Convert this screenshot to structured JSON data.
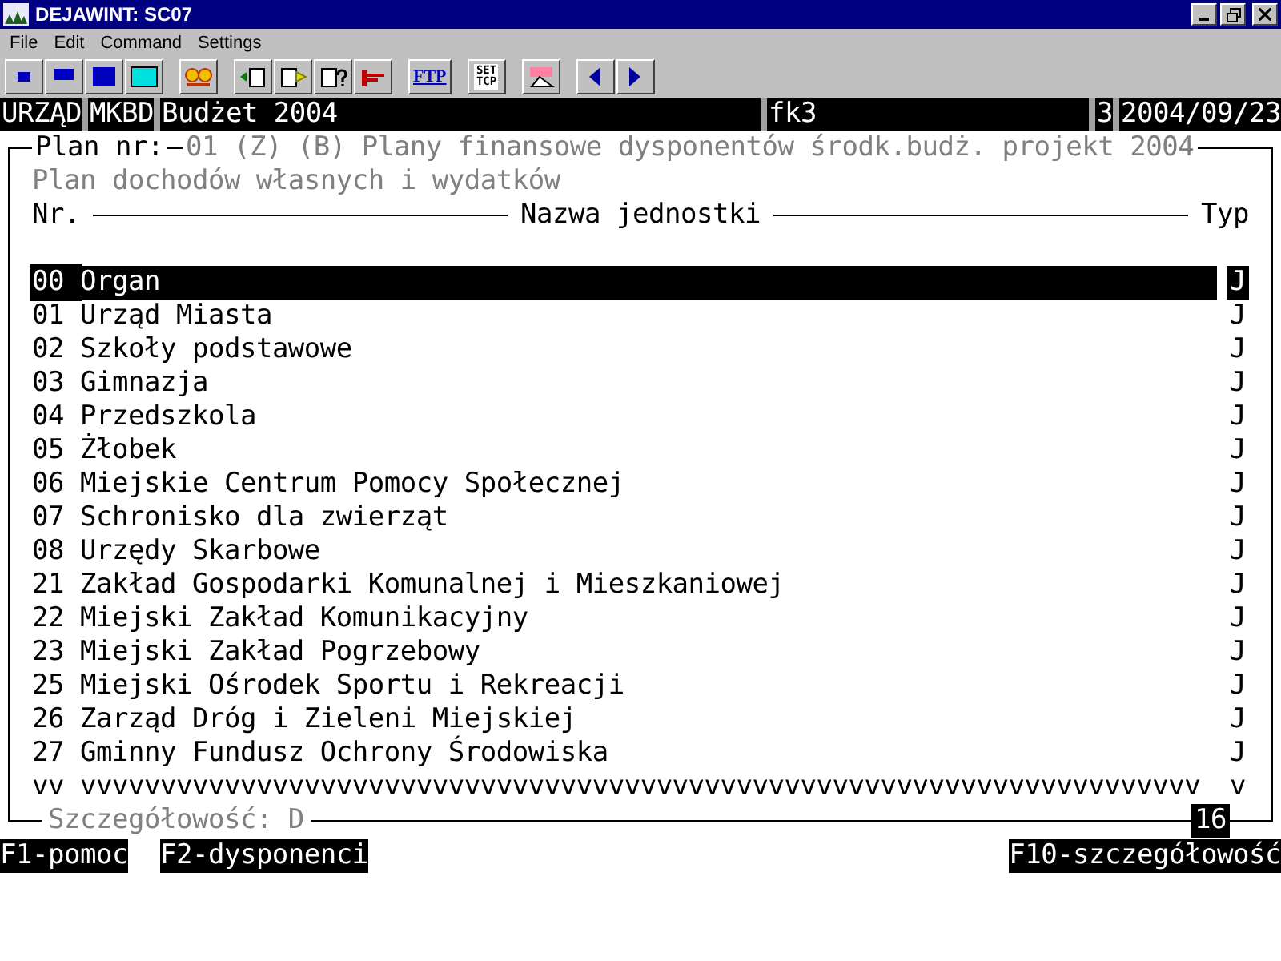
{
  "window": {
    "title": "DEJAWINT:  SC07"
  },
  "menu": [
    "File",
    "Edit",
    "Command",
    "Settings"
  ],
  "toolbar": [
    {
      "kind": "win-small"
    },
    {
      "kind": "win-medium"
    },
    {
      "kind": "win-large"
    },
    {
      "kind": "win-cyan"
    },
    {
      "kind": "flowers"
    },
    {
      "kind": "clip-in"
    },
    {
      "kind": "clip-out"
    },
    {
      "kind": "clip-question"
    },
    {
      "kind": "plug"
    },
    {
      "kind": "label",
      "label": "FTP"
    },
    {
      "kind": "label2",
      "label": "SET",
      "label2": "TCP"
    },
    {
      "kind": "tceip"
    },
    {
      "kind": "left"
    },
    {
      "kind": "right"
    }
  ],
  "status": [
    "URZĄD",
    "MKBD",
    "Budżet 2004",
    "fk3",
    "3",
    "2004/09/23"
  ],
  "plan": {
    "label": "Plan nr:",
    "value": "01 (Z) (B) Plany finansowe dysponentów środk.budż. projekt 2004",
    "subtitle": "Plan dochodów własnych i wydatków"
  },
  "columns": [
    "Nr.",
    "Nazwa jednostki",
    "Typ"
  ],
  "rows": [
    {
      "nr": "00",
      "name": "Organ",
      "type": "J",
      "selected": true
    },
    {
      "nr": "01",
      "name": "Urząd Miasta",
      "type": "J",
      "selected": false
    },
    {
      "nr": "02",
      "name": "Szkoły podstawowe",
      "type": "J",
      "selected": false
    },
    {
      "nr": "03",
      "name": "Gimnazja",
      "type": "J",
      "selected": false
    },
    {
      "nr": "04",
      "name": "Przedszkola",
      "type": "J",
      "selected": false
    },
    {
      "nr": "05",
      "name": "Żłobek",
      "type": "J",
      "selected": false
    },
    {
      "nr": "06",
      "name": "Miejskie Centrum Pomocy Społecznej",
      "type": "J",
      "selected": false
    },
    {
      "nr": "07",
      "name": "Schronisko dla zwierząt",
      "type": "J",
      "selected": false
    },
    {
      "nr": "08",
      "name": "Urzędy Skarbowe",
      "type": "J",
      "selected": false
    },
    {
      "nr": "21",
      "name": "Zakład Gospodarki Komunalnej i Mieszkaniowej",
      "type": "J",
      "selected": false
    },
    {
      "nr": "22",
      "name": "Miejski Zakład Komunikacyjny",
      "type": "J",
      "selected": false
    },
    {
      "nr": "23",
      "name": "Miejski Zakład Pogrzebowy",
      "type": "J",
      "selected": false
    },
    {
      "nr": "25",
      "name": "Miejski Ośrodek Sportu i Rekreacji",
      "type": "J",
      "selected": false
    },
    {
      "nr": "26",
      "name": "Zarząd Dróg i Zieleni Miejskiej",
      "type": "J",
      "selected": false
    },
    {
      "nr": "27",
      "name": "Gminny Fundusz Ochrony Środowiska",
      "type": "J",
      "selected": false
    }
  ],
  "more_marks": {
    "nr": "vv",
    "name": "vvvvvvvvvvvvvvvvvvvvvvvvvvvvvvvvvvvvvvvvvvvvvvvvvvvvvvvvvvvvvvvvvvvvvv",
    "type": "v"
  },
  "footer": {
    "detail": "Szczegółowość: D",
    "count": "16"
  },
  "keys_left": [
    "F1-pomoc",
    "F2-dysponenci"
  ],
  "keys_right": [
    "F10-szczegółowość"
  ]
}
